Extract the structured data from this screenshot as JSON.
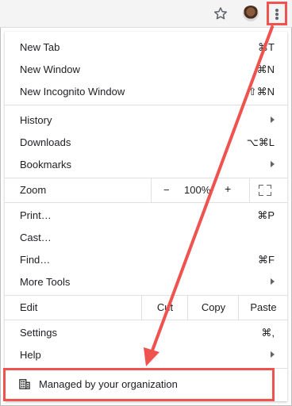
{
  "toolbar": {
    "icons": [
      "star-icon",
      "avatar",
      "more-vertical-icon"
    ],
    "annotation_color": "#ef5350"
  },
  "menu": {
    "group1": [
      {
        "label": "New Tab",
        "shortcut": "⌘T"
      },
      {
        "label": "New Window",
        "shortcut": "⌘N"
      },
      {
        "label": "New Incognito Window",
        "shortcut": "⇧⌘N"
      }
    ],
    "group2": [
      {
        "label": "History",
        "has_submenu": true
      },
      {
        "label": "Downloads",
        "shortcut": "⌥⌘L"
      },
      {
        "label": "Bookmarks",
        "has_submenu": true
      }
    ],
    "zoom": {
      "label": "Zoom",
      "minus": "−",
      "value": "100%",
      "plus": "+"
    },
    "group3": [
      {
        "label": "Print…",
        "shortcut": "⌘P"
      },
      {
        "label": "Cast…"
      },
      {
        "label": "Find…",
        "shortcut": "⌘F"
      },
      {
        "label": "More Tools",
        "has_submenu": true
      }
    ],
    "edit": {
      "label": "Edit",
      "cut": "Cut",
      "copy": "Copy",
      "paste": "Paste"
    },
    "group4": [
      {
        "label": "Settings",
        "shortcut": "⌘,"
      },
      {
        "label": "Help",
        "has_submenu": true
      }
    ],
    "managed": {
      "label": "Managed by your organization"
    }
  }
}
